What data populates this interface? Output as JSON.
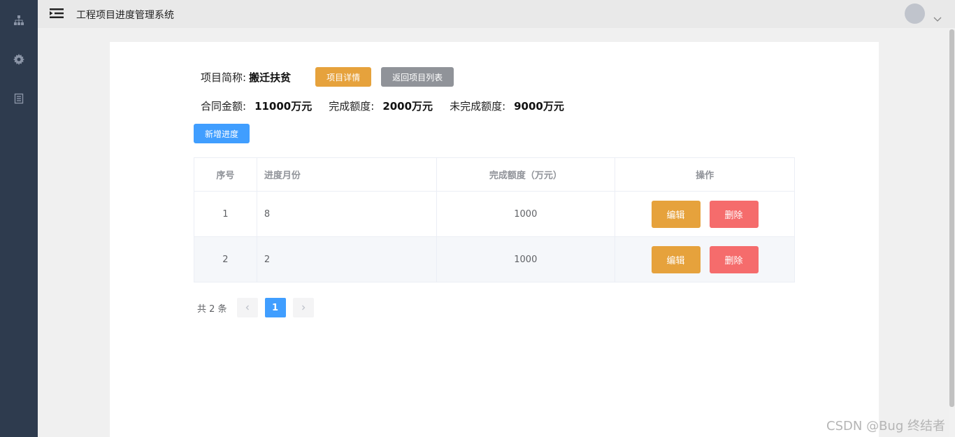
{
  "header": {
    "title": "工程项目进度管理系统"
  },
  "sidebar": {
    "icons": [
      "sitemap-icon",
      "gear-icon",
      "document-icon"
    ]
  },
  "project": {
    "name_label": "项目简称:",
    "name_value": "搬迁扶贫",
    "detail_button": "项目详情",
    "back_button": "返回项目列表",
    "contract_label": "合同金额:",
    "contract_value": "11000万元",
    "completed_label": "完成额度:",
    "completed_value": "2000万元",
    "remaining_label": "未完成额度:",
    "remaining_value": "9000万元"
  },
  "actions": {
    "add_progress": "新增进度"
  },
  "table": {
    "headers": [
      "序号",
      "进度月份",
      "完成额度（万元）",
      "操作"
    ],
    "rows": [
      {
        "index": "1",
        "month": "8",
        "amount": "1000",
        "edit": "编辑",
        "delete": "删除"
      },
      {
        "index": "2",
        "month": "2",
        "amount": "1000",
        "edit": "编辑",
        "delete": "删除"
      }
    ]
  },
  "pagination": {
    "total": "共 2 条",
    "current_page": "1"
  },
  "watermark": "CSDN @Bug 终结者",
  "colors": {
    "sidebar": "#2e3b4e",
    "warning": "#e6a23c",
    "info": "#909399",
    "primary": "#409eff",
    "danger": "#f56c6c"
  }
}
